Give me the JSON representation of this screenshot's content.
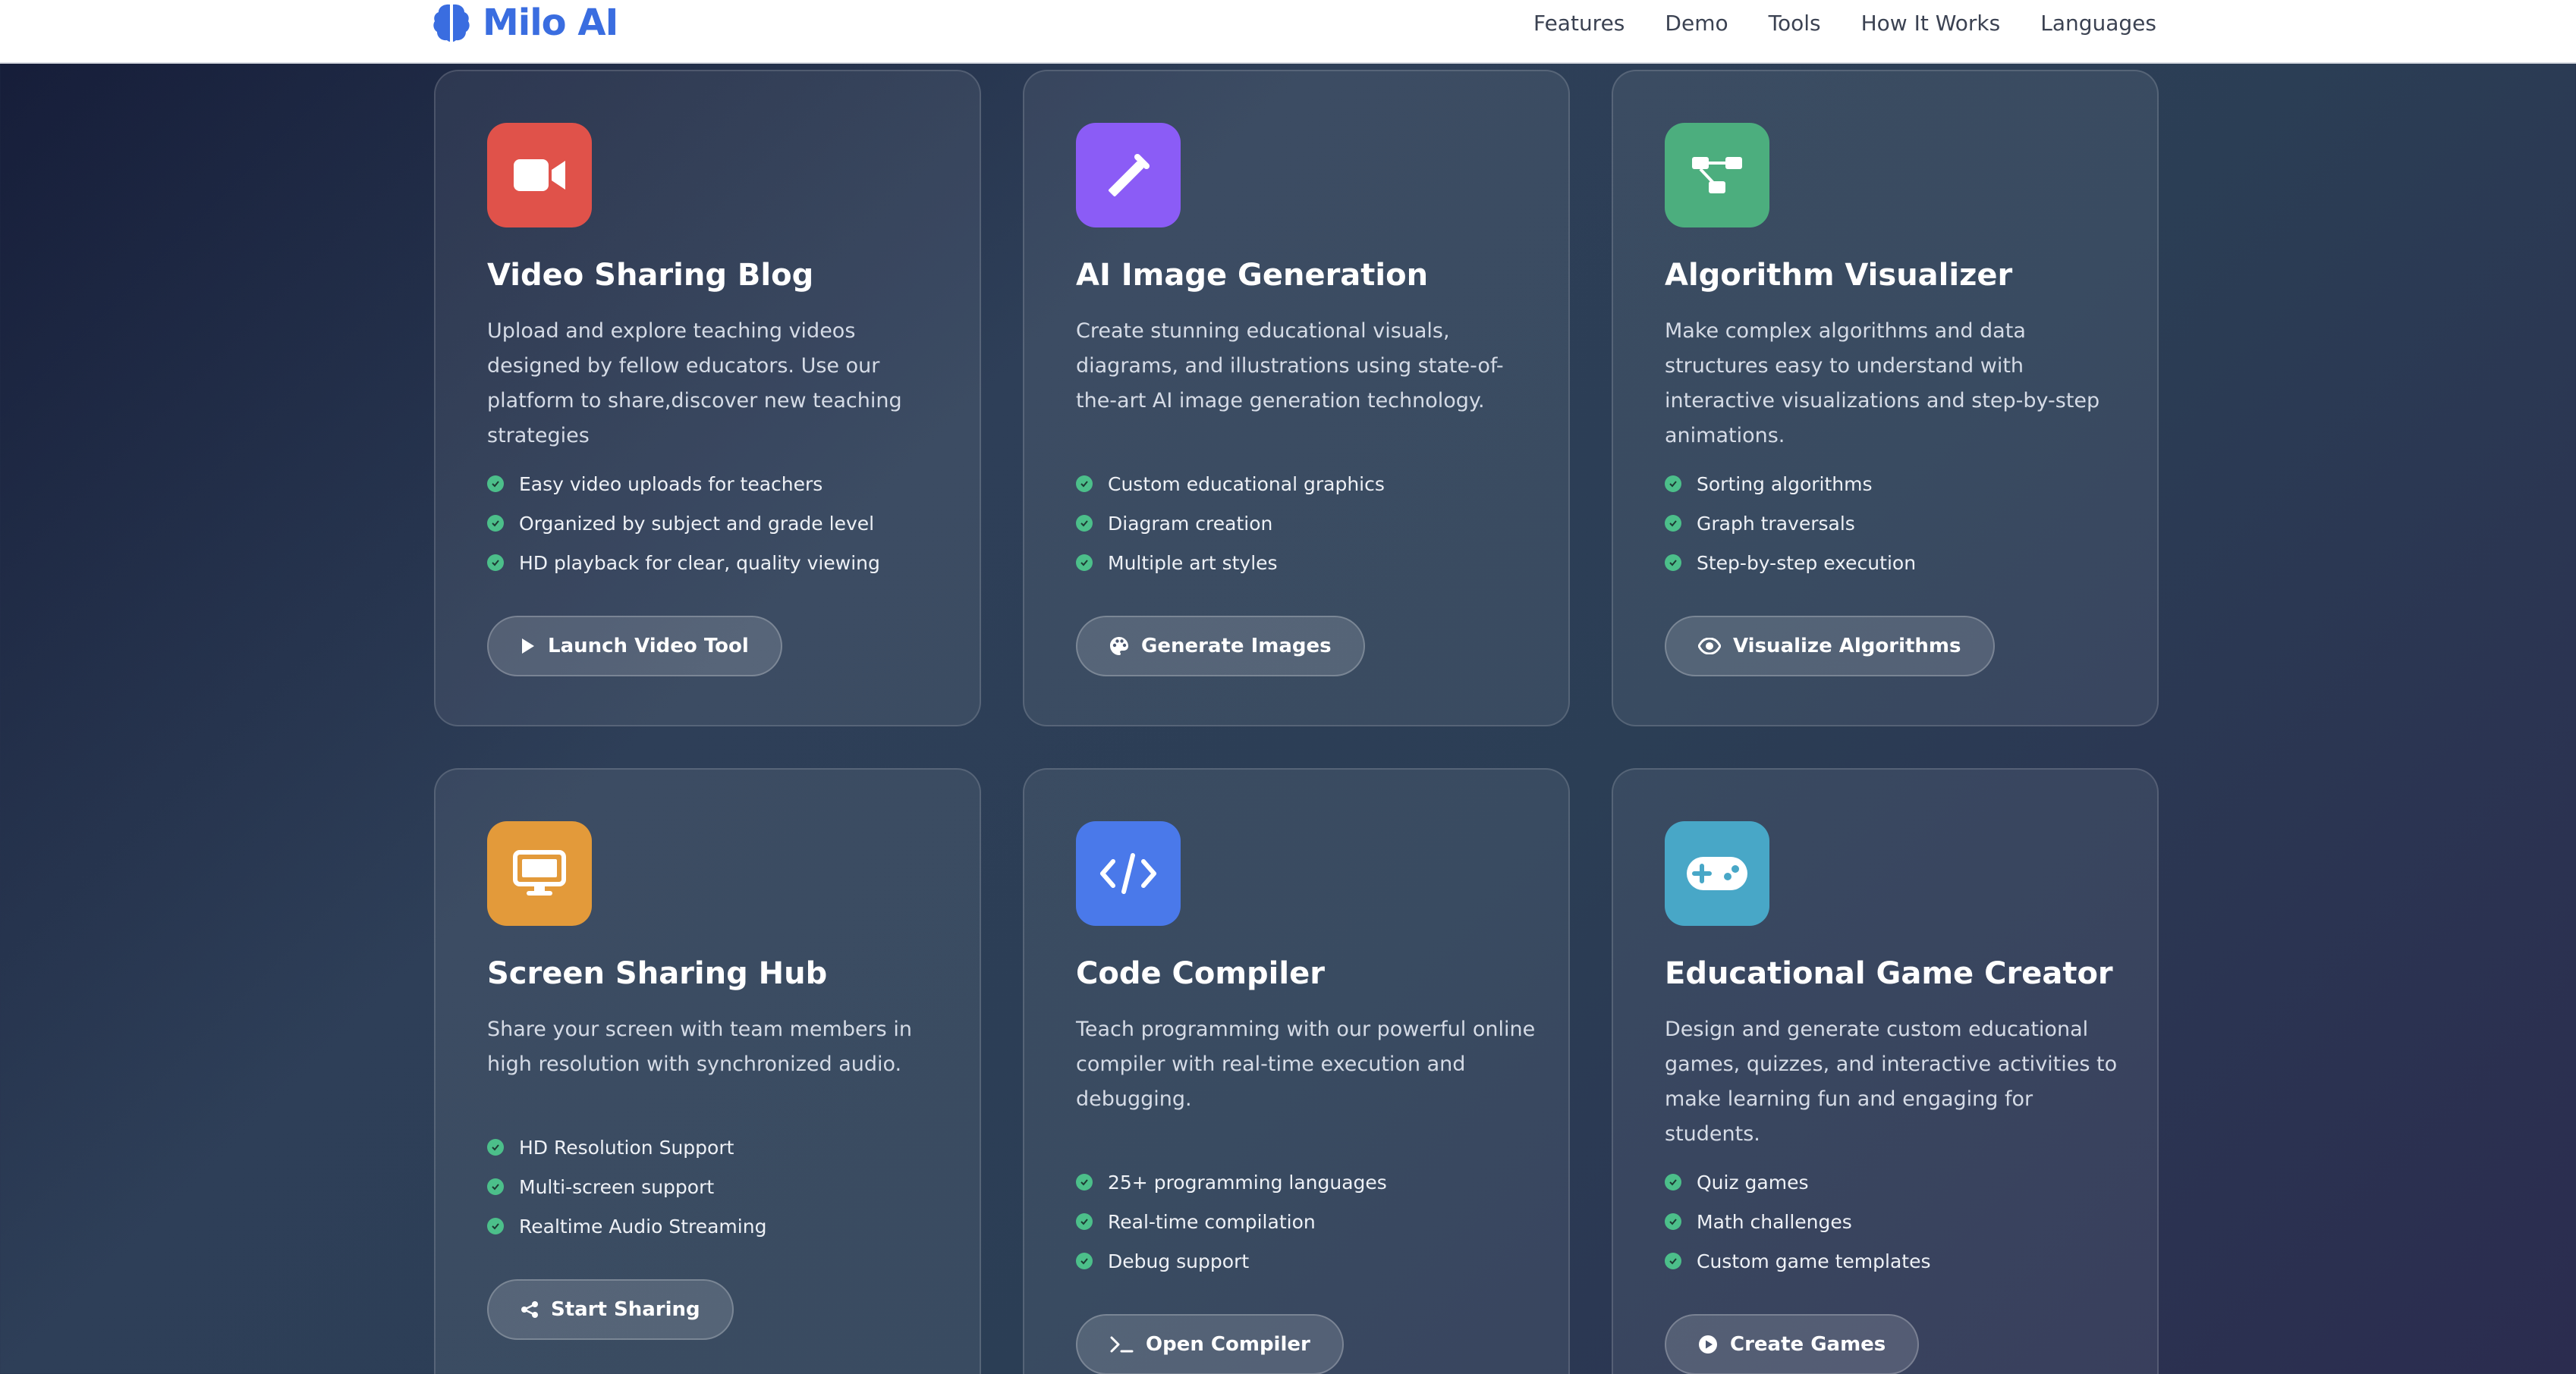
{
  "brand": {
    "name": "Milo AI",
    "icon": "brain-icon",
    "color": "#3a6de0"
  },
  "nav": [
    {
      "label": "Features"
    },
    {
      "label": "Demo"
    },
    {
      "label": "Tools"
    },
    {
      "label": "How It Works"
    },
    {
      "label": "Languages"
    }
  ],
  "tools": [
    {
      "title": "Video Sharing Blog",
      "icon": "video-camera-icon",
      "icon_color": "#e0524a",
      "description": "Upload and explore teaching videos designed by fellow educators. Use our platform to share,discover new teaching strategies",
      "features": [
        "Easy video uploads for teachers",
        "Organized by subject and grade level",
        "HD playback for clear, quality viewing"
      ],
      "button": {
        "label": "Launch Video Tool",
        "icon": "play-icon"
      }
    },
    {
      "title": "AI Image Generation",
      "icon": "magic-wand-icon",
      "icon_color": "#8b5cf6",
      "description": "Create stunning educational visuals, diagrams, and illustrations using state-of-the-art AI image generation technology.",
      "features": [
        "Custom educational graphics",
        "Diagram creation",
        "Multiple art styles"
      ],
      "button": {
        "label": "Generate Images",
        "icon": "palette-icon"
      }
    },
    {
      "title": "Algorithm Visualizer",
      "icon": "diagram-icon",
      "icon_color": "#4cae7e",
      "description": "Make complex algorithms and data structures easy to understand with interactive visualizations and step-by-step animations.",
      "features": [
        "Sorting algorithms",
        "Graph traversals",
        "Step-by-step execution"
      ],
      "button": {
        "label": "Visualize Algorithms",
        "icon": "eye-icon"
      }
    },
    {
      "title": "Screen Sharing Hub",
      "icon": "desktop-icon",
      "icon_color": "#e39a3a",
      "description": "Share your screen with team members in high resolution with synchronized audio.",
      "features": [
        "HD Resolution Support",
        "Multi-screen support",
        "Realtime Audio Streaming"
      ],
      "button": {
        "label": "Start Sharing",
        "icon": "share-icon"
      }
    },
    {
      "title": "Code Compiler",
      "icon": "code-icon",
      "icon_color": "#4a79ea",
      "description": "Teach programming with our powerful online compiler with real-time execution and debugging.",
      "features": [
        "25+ programming languages",
        "Real-time compilation",
        "Debug support"
      ],
      "button": {
        "label": "Open Compiler",
        "icon": "terminal-icon"
      }
    },
    {
      "title": "Educational Game Creator",
      "icon": "gamepad-icon",
      "icon_color": "#48a7c7",
      "description": "Design and generate custom educational games, quizzes, and interactive activities to make learning fun and engaging for students.",
      "features": [
        "Quiz games",
        "Math challenges",
        "Custom game templates"
      ],
      "button": {
        "label": "Create Games",
        "icon": "play-circle-icon"
      }
    }
  ]
}
